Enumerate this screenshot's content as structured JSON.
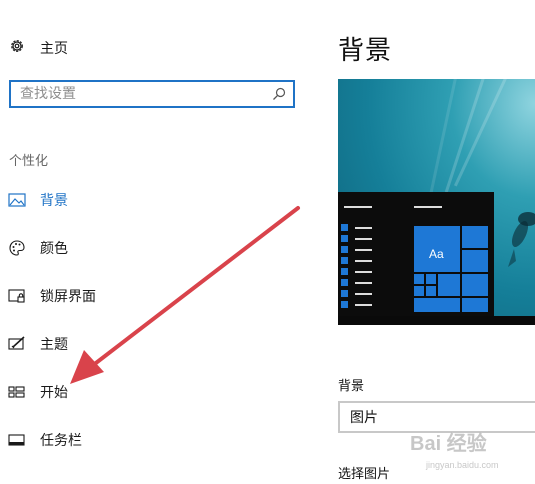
{
  "sidebar": {
    "home": {
      "label": "主页",
      "icon": "gear-icon"
    },
    "search": {
      "placeholder": "查找设置",
      "value": ""
    },
    "section_title": "个性化",
    "items": [
      {
        "label": "背景",
        "icon": "picture-icon",
        "active": true
      },
      {
        "label": "颜色",
        "icon": "palette-icon",
        "active": false
      },
      {
        "label": "锁屏界面",
        "icon": "lock-screen-icon",
        "active": false
      },
      {
        "label": "主题",
        "icon": "theme-icon",
        "active": false
      },
      {
        "label": "开始",
        "icon": "start-menu-icon",
        "active": false
      },
      {
        "label": "任务栏",
        "icon": "taskbar-icon",
        "active": false
      }
    ]
  },
  "main": {
    "title": "背景",
    "preview": {
      "tile_label": "Aa"
    },
    "background_label": "背景",
    "background_value": "图片",
    "choose_picture_label": "选择图片"
  },
  "watermark": {
    "text": "Bai 经验",
    "subtext": "jingyan.baidu.com"
  },
  "colors": {
    "accent": "#1f73c6",
    "annotation_arrow": "#d9434b"
  }
}
